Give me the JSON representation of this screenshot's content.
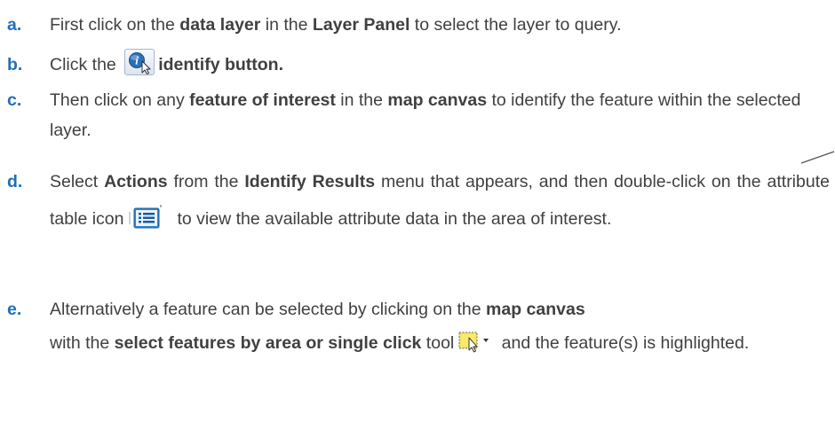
{
  "steps": [
    {
      "label": "a.",
      "parts": [
        "First click on the ",
        "data layer",
        " in the ",
        "Layer Panel",
        " to select the layer to query."
      ]
    },
    {
      "label": "b.",
      "parts": [
        "Click the ",
        "identify button."
      ]
    },
    {
      "label": "c.",
      "parts": [
        "Then click on any ",
        "feature of interest",
        " in the ",
        "map canvas",
        " to identify the feature within the selected layer."
      ]
    },
    {
      "label": "d.",
      "parts": [
        "Select ",
        "Actions",
        " from the ",
        "Identify Results",
        " menu that appears, and then double-click on the attribute table icon",
        "to view the available attribute data in the area of interest."
      ]
    },
    {
      "label": "e.",
      "parts": [
        "Alternatively a feature can be selected by clicking on the ",
        "map canvas",
        "with the ",
        "select features by area or single click",
        " tool",
        " and the feature(s) is highlighted."
      ]
    }
  ],
  "icons": {
    "identify": "identify-icon",
    "attribute_table": "attribute-table-icon",
    "select_features": "select-features-icon"
  },
  "colors": {
    "label": "#1f6fb6",
    "text": "#404040"
  }
}
